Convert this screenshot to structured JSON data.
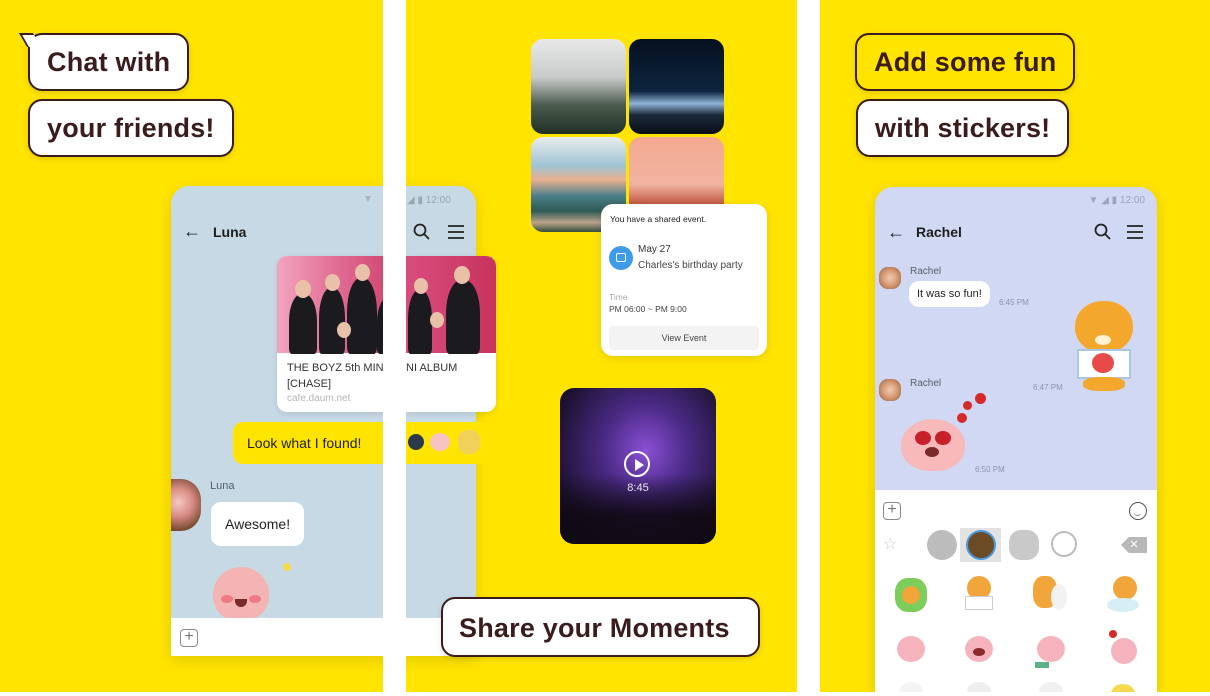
{
  "panels": [
    {
      "caption_lines": [
        "Chat with",
        "your friends!"
      ],
      "chat": {
        "status_time": "12:00",
        "contact_name": "Luna",
        "link_card": {
          "title_line1": "THE BOYZ 5th MINI ALBUM",
          "title_line1_left": "THE BOYZ 5th MIN",
          "title_line1_right": "NI ALBUM",
          "title_line2": "[CHASE]",
          "domain": "cafe.daum.net"
        },
        "sent_message": "Look what I found!",
        "received": {
          "sender": "Luna",
          "message": "Awesome!"
        }
      }
    },
    {
      "caption": "Share your Moments",
      "event_card": {
        "heading": "You have a shared event.",
        "date": "May 27",
        "event_name": "Charles's birthday party",
        "time_label": "Time",
        "time_value": "PM 06:00 ~ PM 9:00",
        "button_label": "View Event"
      },
      "video": {
        "duration": "8:45"
      }
    },
    {
      "caption_lines": [
        "Add some fun",
        "with stickers!"
      ],
      "chat": {
        "status_time": "12:00",
        "contact_name": "Rachel",
        "messages": [
          {
            "sender": "Rachel",
            "text": "It was so fun!",
            "time": "6:45 PM"
          },
          {
            "sender": "",
            "text": "",
            "time": "6:47 PM",
            "type": "sticker-sent"
          },
          {
            "sender": "Rachel",
            "text": "",
            "time": "6:50 PM",
            "type": "sticker-received"
          }
        ]
      },
      "sticker_tabs": [
        "recent-icon",
        "sticker-pack-1",
        "sticker-pack-2",
        "sticker-pack-3",
        "emoji-icon"
      ],
      "selected_tab": 2
    }
  ],
  "colors": {
    "brand_yellow": "#FFE400",
    "caption_text": "#3a1c1c",
    "chat_bg_luna": "#c7d9e5",
    "chat_bg_rachel": "#d0d8f3",
    "event_icon": "#3d9be9"
  }
}
